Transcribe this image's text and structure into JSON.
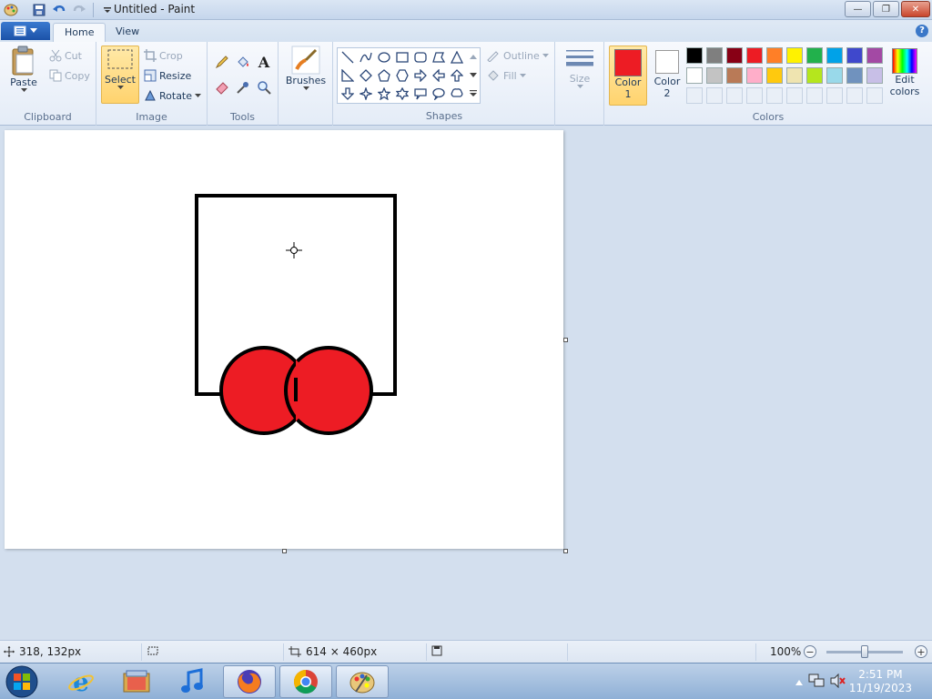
{
  "window": {
    "title": "Untitled - Paint",
    "minimize": "—",
    "maximize": "❐",
    "close": "✕"
  },
  "tabs": [
    {
      "label": "Home",
      "active": true
    },
    {
      "label": "View",
      "active": false
    }
  ],
  "ribbon": {
    "clipboard": {
      "label": "Clipboard",
      "paste": "Paste",
      "cut": "Cut",
      "copy": "Copy"
    },
    "image": {
      "label": "Image",
      "select": "Select",
      "crop": "Crop",
      "resize": "Resize",
      "rotate": "Rotate"
    },
    "tools": {
      "label": "Tools"
    },
    "brushes": {
      "label": "Brushes"
    },
    "shapes": {
      "label": "Shapes",
      "outline": "Outline",
      "fill": "Fill"
    },
    "size": {
      "label": "Size"
    },
    "colors": {
      "label": "Colors",
      "color1_line1": "Color",
      "color1_line2": "1",
      "color2_line1": "Color",
      "color2_line2": "2",
      "edit_line1": "Edit",
      "edit_line2": "colors",
      "color1_value": "#ed1c24",
      "color2_value": "#ffffff",
      "palette_row1": [
        "#000000",
        "#7f7f7f",
        "#880015",
        "#ed1c24",
        "#ff7f27",
        "#fff200",
        "#22b14c",
        "#00a2e8",
        "#3f48cc",
        "#a349a4"
      ],
      "palette_row2": [
        "#ffffff",
        "#c3c3c3",
        "#b97a57",
        "#ffaec9",
        "#ffc90e",
        "#efe4b0",
        "#b5e61d",
        "#99d9ea",
        "#7092be",
        "#c8bfe7"
      ]
    }
  },
  "status": {
    "cursor_pos": "318, 132px",
    "canvas_size": "614 × 460px",
    "zoom": "100%"
  },
  "taskbar": {
    "time": "2:51 PM",
    "date": "11/19/2023"
  }
}
